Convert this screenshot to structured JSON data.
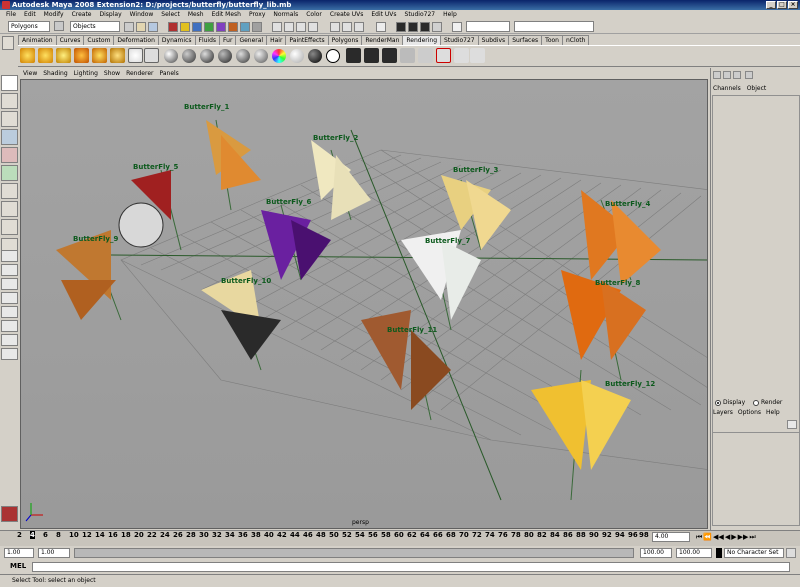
{
  "window": {
    "title": "Autodesk Maya 2008 Extension2: D:/projects/butterfly/butterfly_lib.mb"
  },
  "menu": [
    "File",
    "Edit",
    "Modify",
    "Create",
    "Display",
    "Window",
    "Select",
    "Mesh",
    "Edit Mesh",
    "Proxy",
    "Normals",
    "Color",
    "Create UVs",
    "Edit UVs",
    "Studio727",
    "Help"
  ],
  "status_line": {
    "mode_select": "Polygons",
    "mask_select": "Objects"
  },
  "shelf_tabs": [
    "Animation",
    "Curves",
    "Custom",
    "Deformation",
    "Dynamics",
    "Fluids",
    "Fur",
    "General",
    "Hair",
    "PaintEffects",
    "Polygons",
    "RenderMan",
    "Rendering",
    "Studio727",
    "Subdivs",
    "Surfaces",
    "Toon",
    "nCloth"
  ],
  "shelf_active": "Rendering",
  "panel_menu": [
    "View",
    "Shading",
    "Lighting",
    "Show",
    "Renderer",
    "Panels"
  ],
  "viewport": {
    "camera": "persp",
    "labels": [
      "ButterFly_1",
      "ButterFly_2",
      "ButterFly_3",
      "ButterFly_4",
      "ButterFly_5",
      "ButterFly_6",
      "ButterFly_7",
      "ButterFly_8",
      "ButterFly_9",
      "ButterFly_10",
      "ButterFly_11",
      "ButterFly_12"
    ]
  },
  "channel_box": {
    "tabs": [
      "Channels",
      "Object"
    ]
  },
  "layer_editor": {
    "display_label": "Display",
    "render_label": "Render",
    "display_selected": true,
    "menu": [
      "Layers",
      "Options",
      "Help"
    ]
  },
  "timeline": {
    "ticks": [
      "2",
      "4",
      "6",
      "8",
      "10",
      "12",
      "14",
      "16",
      "18",
      "20",
      "22",
      "24",
      "26",
      "28",
      "30",
      "32",
      "34",
      "36",
      "38",
      "40",
      "42",
      "44",
      "46",
      "48",
      "50",
      "52",
      "54",
      "56",
      "58",
      "60",
      "62",
      "64",
      "66",
      "68",
      "70",
      "72",
      "74",
      "76",
      "78",
      "80",
      "82",
      "84",
      "86",
      "88",
      "90",
      "92",
      "94",
      "96",
      "98",
      "100"
    ],
    "current_frame": "4.00"
  },
  "range": {
    "start": "1.00",
    "range_start": "1.00",
    "range_end": "100.00",
    "end": "100.00",
    "character_set": "No Character Set"
  },
  "mel": {
    "label": "MEL"
  },
  "help_line": "Select Tool: select an object"
}
